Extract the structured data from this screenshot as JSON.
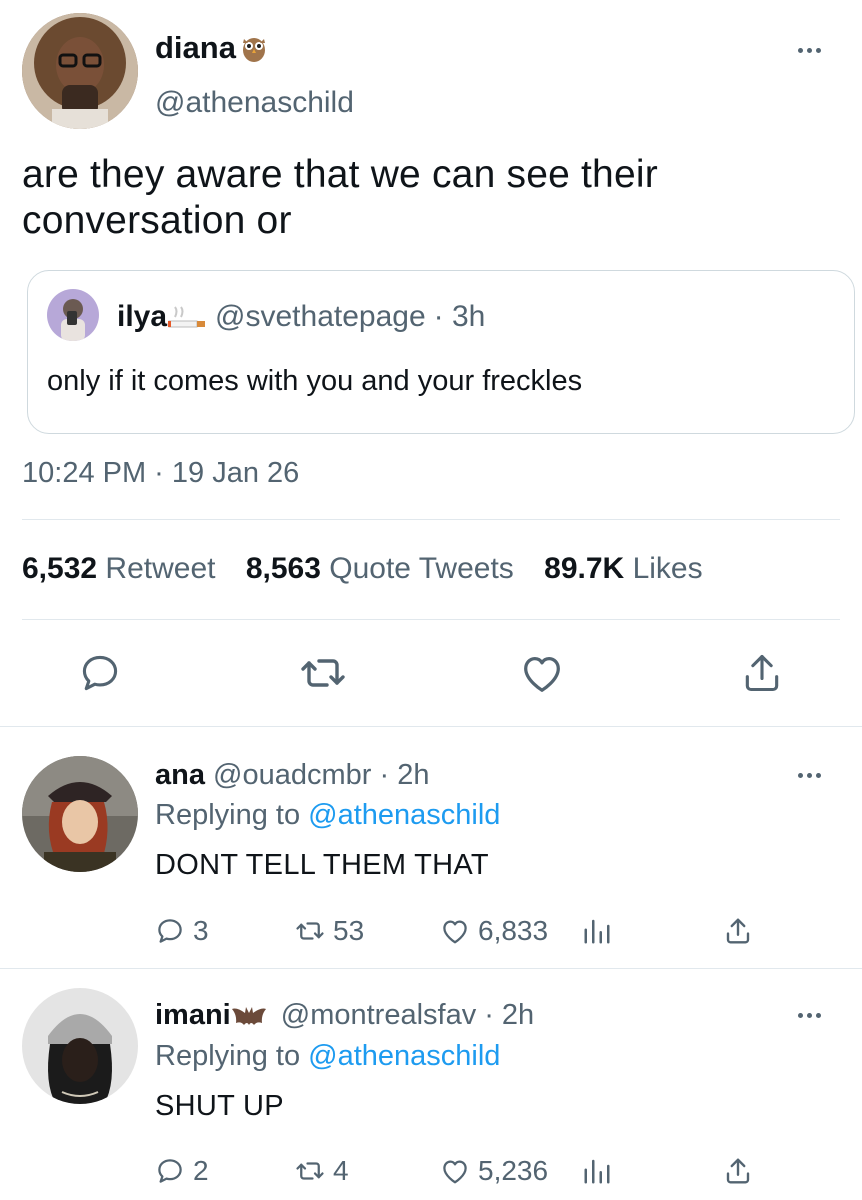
{
  "main_tweet": {
    "display_name": "diana",
    "handle": "@athenaschild",
    "text_line1": "are they aware that we can see their",
    "text_line2": "conversation or",
    "timestamp": "10:24 PM · 19 Jan 26",
    "stats": {
      "retweets_count": "6,532",
      "retweets_label": "Retweet",
      "quotes_count": "8,563",
      "quotes_label": "Quote Tweets",
      "likes_count": "89.7K",
      "likes_label": "Likes"
    }
  },
  "quoted_tweet": {
    "display_name": "ilya",
    "handle": "@svethatepage",
    "time": "· 3h",
    "text": "only if it comes with you and your freckles"
  },
  "replies": [
    {
      "display_name": "ana",
      "handle": "@ouadcmbr",
      "time": "· 2h",
      "replying_prefix": "Replying to",
      "replying_handle": "@athenaschild",
      "text": "DONT TELL THEM THAT",
      "reply_count": "3",
      "retweet_count": "53",
      "like_count": "6,833"
    },
    {
      "display_name": "imani",
      "handle": "@montrealsfav",
      "time": "· 2h",
      "replying_prefix": "Replying to",
      "replying_handle": "@athenaschild",
      "text": "SHUT UP",
      "reply_count": "2",
      "retweet_count": "4",
      "like_count": "5,236"
    }
  ],
  "colors": {
    "link_blue": "#1d9bf0",
    "secondary_gray": "#536471",
    "divider": "#e1e8ed"
  },
  "icons": [
    "owl-emoji-icon",
    "cigarette-emoji-icon",
    "bat-emoji-icon",
    "more-icon",
    "reply-icon",
    "retweet-icon",
    "like-icon",
    "share-icon",
    "analytics-icon"
  ]
}
